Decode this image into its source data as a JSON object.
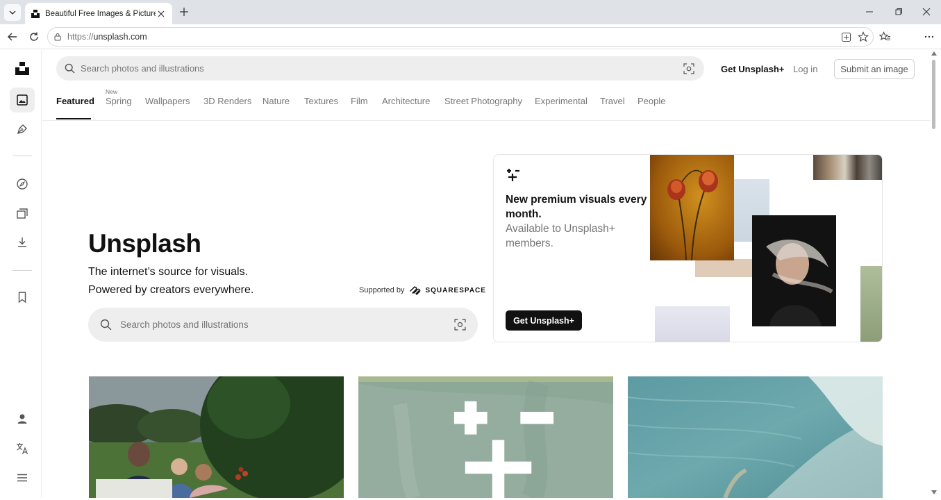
{
  "browser": {
    "tab_title": "Beautiful Free Images & Pictures | Unsplash",
    "url_protocol": "https://",
    "url_host": "unsplash.com"
  },
  "header": {
    "search_placeholder": "Search photos and illustrations",
    "get_plus": "Get Unsplash+",
    "login": "Log in",
    "submit": "Submit an image"
  },
  "topics": {
    "items": [
      "Featured",
      "Spring",
      "Wallpapers",
      "3D Renders",
      "Nature",
      "Textures",
      "Film",
      "Architecture",
      "Street Photography",
      "Experimental",
      "Travel",
      "People"
    ],
    "active": "Featured",
    "new_badge": "New"
  },
  "hero": {
    "title": "Unsplash",
    "line1": "The internet’s source for visuals.",
    "line2": "Powered by creators everywhere.",
    "supported_by": "Supported by",
    "sponsor": "SQUARESPACE",
    "search_placeholder": "Search photos and illustrations"
  },
  "promo": {
    "headline": "New premium visuals every month.",
    "sub": "Available to Unsplash+ members.",
    "button": "Get Unsplash+"
  },
  "rail": {
    "items": [
      "logo-icon",
      "photos-icon",
      "illustrations-icon",
      "explore-icon",
      "collections-icon",
      "downloads-icon",
      "bookmark-icon",
      "profile-icon",
      "language-icon",
      "menu-icon"
    ]
  },
  "colors": {
    "text_primary": "#111111",
    "text_secondary": "#767676",
    "search_bg": "#eeeeee",
    "button_dark": "#111111"
  }
}
